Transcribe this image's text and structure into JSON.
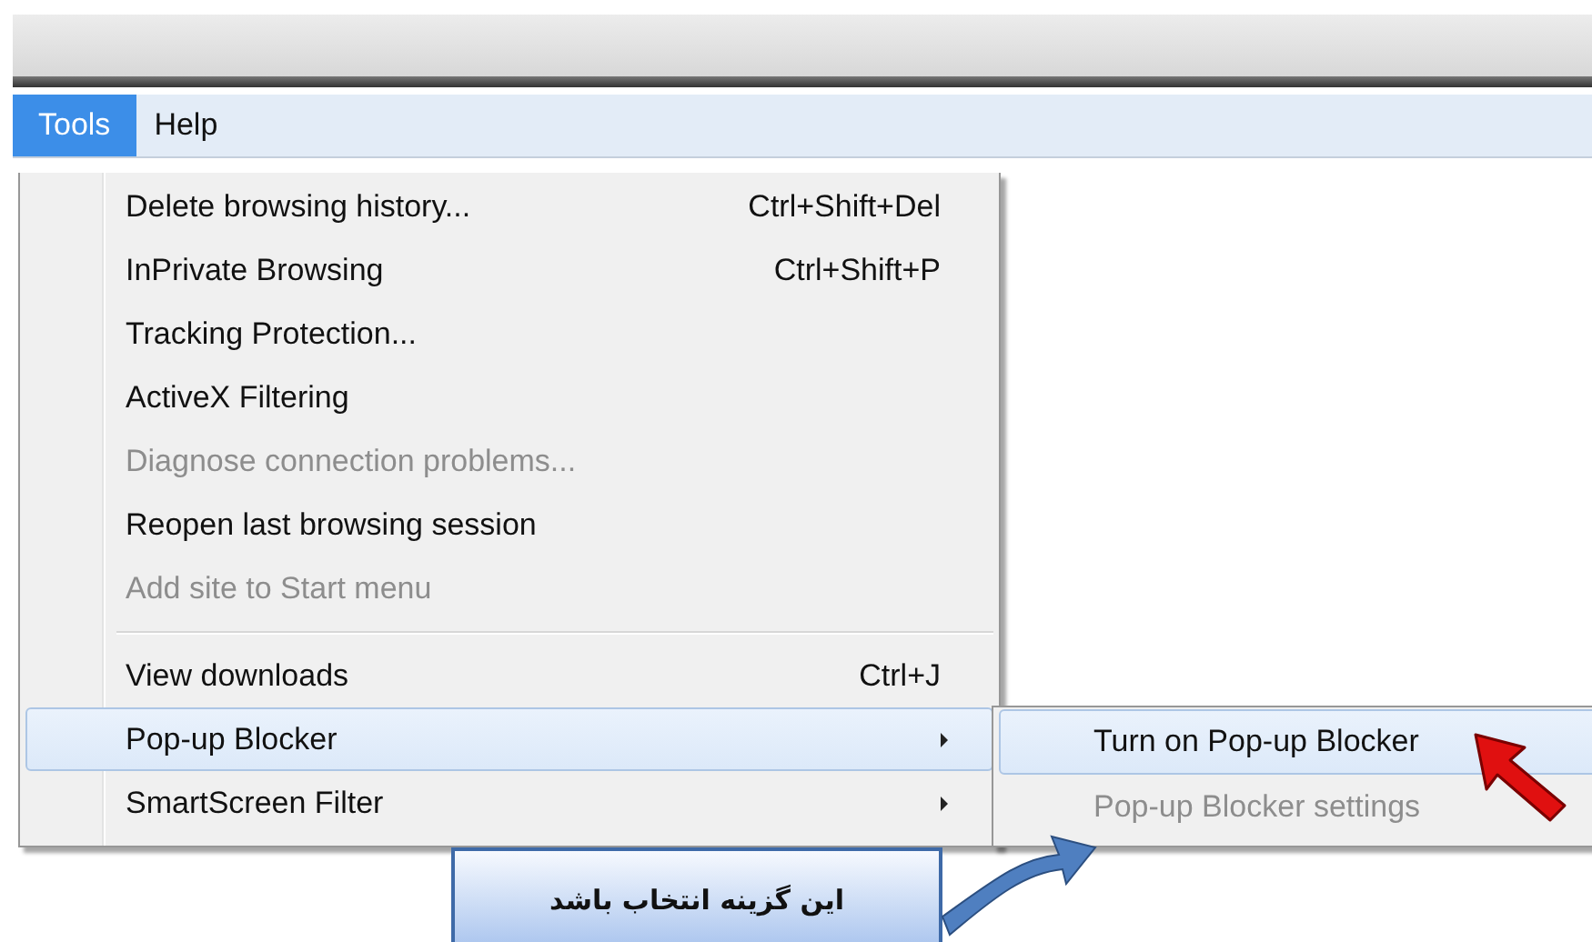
{
  "menubar": [
    {
      "label": "Tools",
      "selected": true
    },
    {
      "label": "Help",
      "selected": false
    }
  ],
  "menu": [
    {
      "kind": "item",
      "label": "Delete browsing history...",
      "shortcut": "Ctrl+Shift+Del",
      "disabled": false,
      "selected": false
    },
    {
      "kind": "item",
      "label": "InPrivate Browsing",
      "shortcut": "Ctrl+Shift+P",
      "disabled": false,
      "selected": false
    },
    {
      "kind": "item",
      "label": "Tracking Protection...",
      "disabled": false,
      "selected": false
    },
    {
      "kind": "item",
      "label": "ActiveX Filtering",
      "disabled": false,
      "selected": false
    },
    {
      "kind": "item",
      "label": "Diagnose connection problems...",
      "disabled": true,
      "selected": false
    },
    {
      "kind": "item",
      "label": "Reopen last browsing session",
      "disabled": false,
      "selected": false
    },
    {
      "kind": "item",
      "label": "Add site to Start menu",
      "disabled": true,
      "selected": false
    },
    {
      "kind": "separator"
    },
    {
      "kind": "item",
      "label": "View downloads",
      "shortcut": "Ctrl+J",
      "disabled": false,
      "selected": false
    },
    {
      "kind": "submenu",
      "label": "Pop-up Blocker",
      "disabled": false,
      "selected": true
    },
    {
      "kind": "submenu",
      "label": "SmartScreen Filter",
      "disabled": false,
      "selected": false
    }
  ],
  "submenu": [
    {
      "label": "Turn on Pop-up Blocker",
      "disabled": false,
      "selected": true
    },
    {
      "label": "Pop-up Blocker settings",
      "disabled": true,
      "selected": false
    }
  ],
  "callout": {
    "text": "این گزینه انتخاب باشد"
  }
}
